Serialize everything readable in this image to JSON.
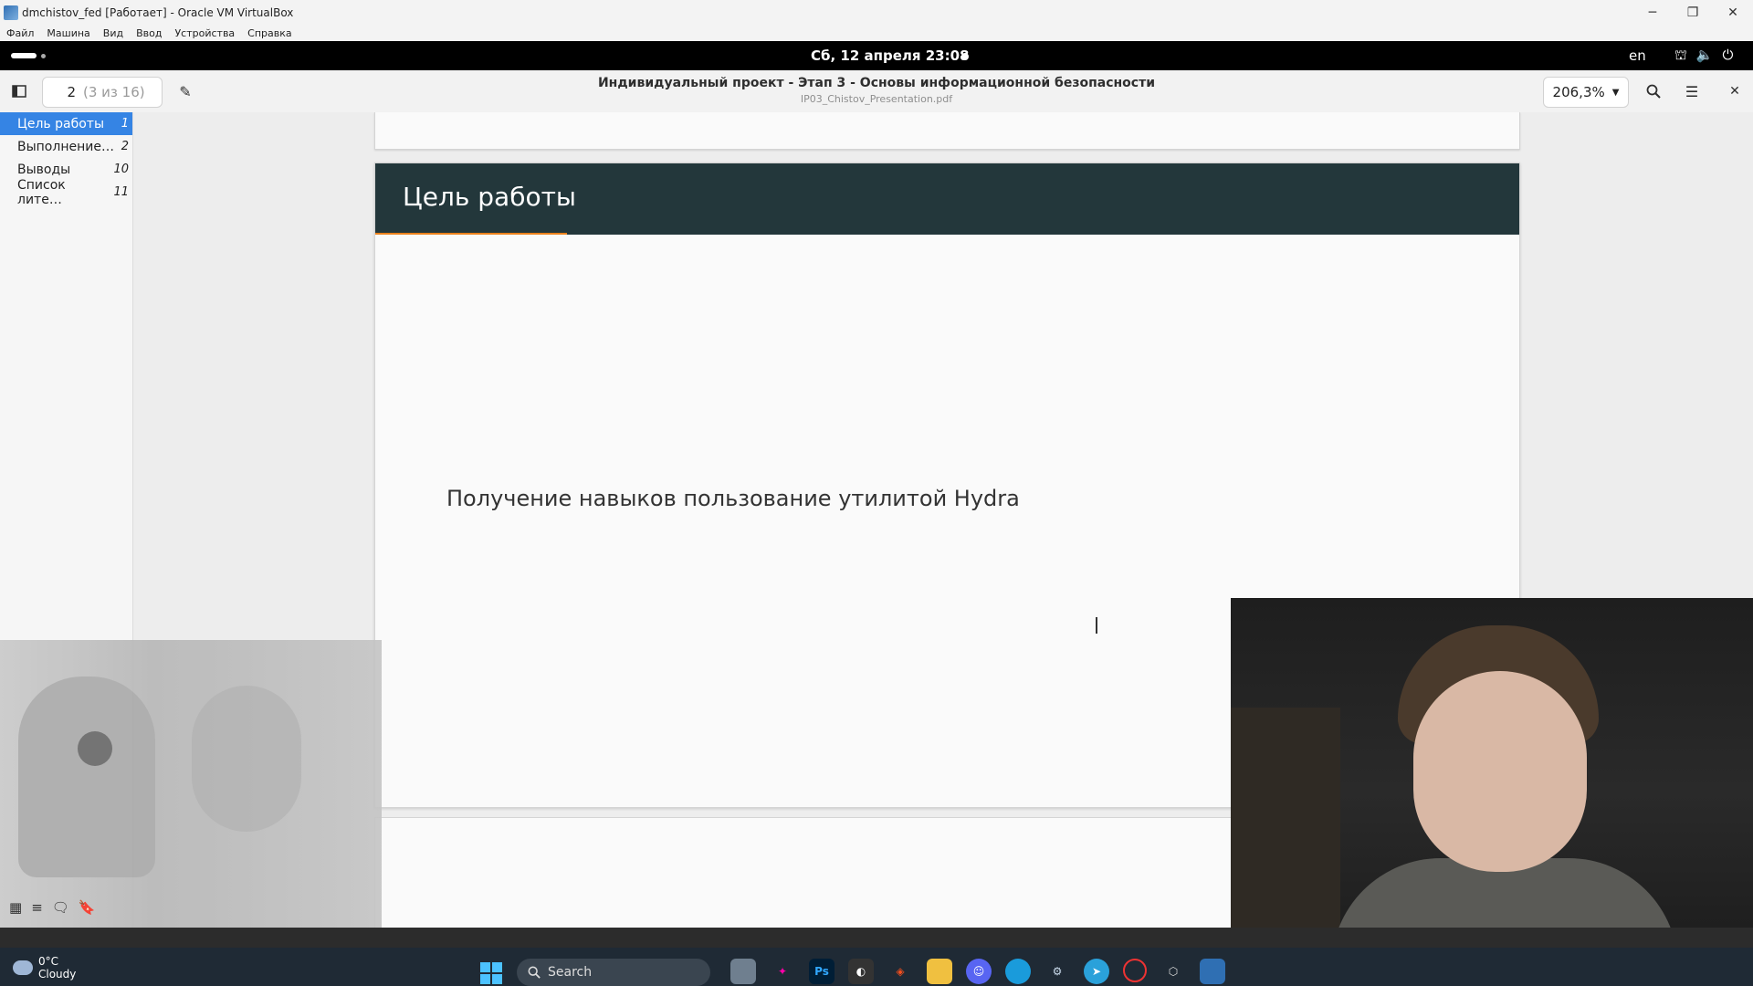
{
  "vbox": {
    "title": "dmchistov_fed [Работает] - Oracle VM VirtualBox",
    "menu": [
      "Файл",
      "Машина",
      "Вид",
      "Ввод",
      "Устройства",
      "Справка"
    ]
  },
  "gnome": {
    "clock": "Сб, 12 апреля  23:08",
    "lang": "en"
  },
  "viewer": {
    "page_number": "2",
    "page_of": "(3 из 16)",
    "title": "Индивидуальный проект - Этап 3 - Основы информационной безопасности",
    "filename": "IP03_Chistov_Presentation.pdf",
    "zoom": "206,3%"
  },
  "toc": [
    {
      "label": "Цель работы",
      "page": "1",
      "active": true
    },
    {
      "label": "Выполнение…",
      "page": "2",
      "active": false
    },
    {
      "label": "Выводы",
      "page": "10",
      "active": false
    },
    {
      "label": "Список лите…",
      "page": "11",
      "active": false
    }
  ],
  "slide": {
    "title": "Цель работы",
    "body": "Получение навыков пользование утилитой Hydra",
    "header_color": "#23373b",
    "accent_color": "#eb811b"
  },
  "taskbar": {
    "temperature": "0°C",
    "weather": "Cloudy",
    "search_label": "Search",
    "icons": [
      "cursor-icon",
      "globe-icon",
      "task-view-icon",
      "star-icon",
      "photoshop-icon",
      "davinci-icon",
      "figma-icon",
      "folder-icon",
      "discord-icon",
      "edge-icon",
      "steam-icon",
      "telegram-icon",
      "opera-icon",
      "box-icon",
      "virtualbox-icon"
    ],
    "icon_labels": {
      "photoshop": "Ps"
    }
  },
  "accent": "#3584e4"
}
